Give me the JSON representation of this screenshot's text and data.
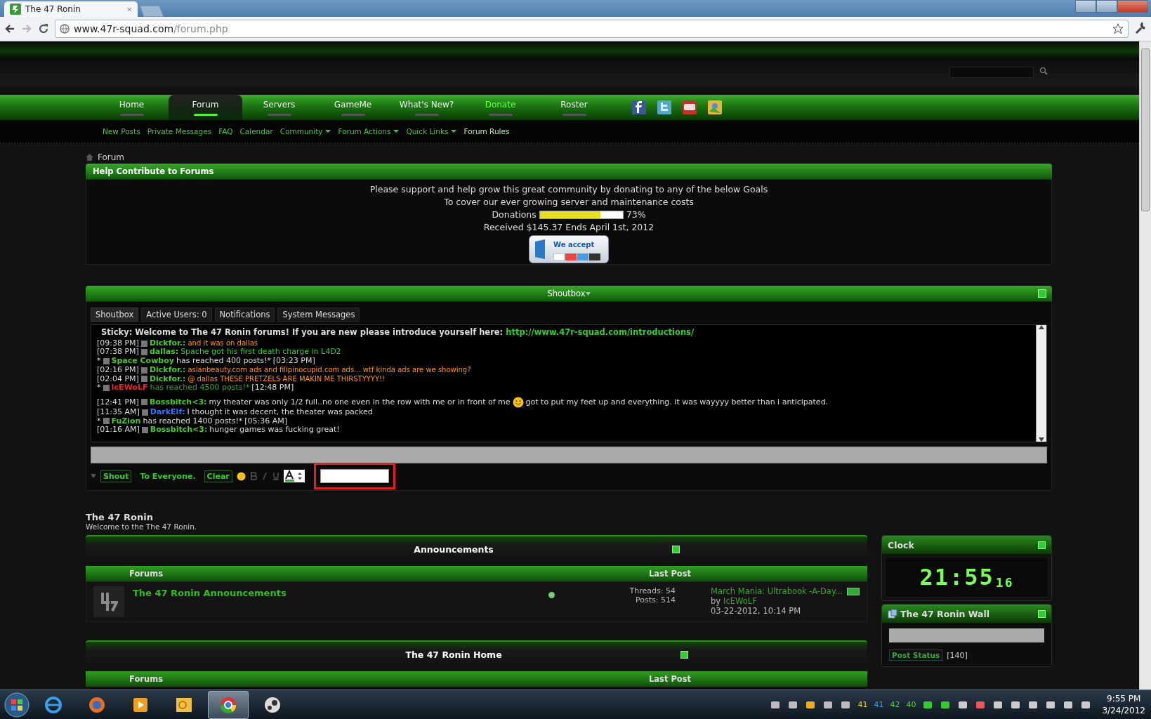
{
  "browser": {
    "tab_title": "The 47 Ronin",
    "tab_close": "×",
    "url_host": "www.47r-squad.com",
    "url_path": "/forum.php"
  },
  "nav": [
    {
      "label": "Home",
      "selected": false,
      "highlighted": false
    },
    {
      "label": "Forum",
      "selected": true,
      "highlighted": false
    },
    {
      "label": "Servers",
      "selected": false,
      "highlighted": false
    },
    {
      "label": "GameMe",
      "selected": false,
      "highlighted": false
    },
    {
      "label": "What's New?",
      "selected": false,
      "highlighted": false
    },
    {
      "label": "Donate",
      "selected": false,
      "highlighted": true
    },
    {
      "label": "Roster",
      "selected": false,
      "highlighted": false
    }
  ],
  "social": [
    {
      "kind": "facebook",
      "color": "#3b5998"
    },
    {
      "kind": "twitter",
      "color": "#5aa6c8"
    },
    {
      "kind": "youtube",
      "color": "#c4302b"
    },
    {
      "kind": "maps",
      "color": "#e8b43a"
    }
  ],
  "subnav": [
    {
      "label": "New Posts",
      "dropdown": false,
      "current": false
    },
    {
      "label": "Private Messages",
      "dropdown": false,
      "current": false
    },
    {
      "label": "FAQ",
      "dropdown": false,
      "current": false
    },
    {
      "label": "Calendar",
      "dropdown": false,
      "current": false
    },
    {
      "label": "Community",
      "dropdown": true,
      "current": false
    },
    {
      "label": "Forum Actions",
      "dropdown": true,
      "current": false
    },
    {
      "label": "Quick Links",
      "dropdown": true,
      "current": false
    },
    {
      "label": "Forum Rules",
      "dropdown": false,
      "current": true
    }
  ],
  "breadcrumb": "Forum",
  "donation": {
    "title": "Help Contribute to Forums",
    "lines": [
      "Please support and help grow this great community by donating to any of the below Goals",
      "To cover our ever growing server and maintenance costs"
    ],
    "bar_label": "Donations",
    "level": 0.73,
    "percent": "73%",
    "received": "Received $145.37 Ends April 1st, 2012",
    "badge": "We accept"
  },
  "shoutbox": {
    "title": "Shoutbox",
    "tabs": [
      {
        "label": "Shoutbox",
        "selected": true
      },
      {
        "label": "Active Users: 0",
        "selected": false
      },
      {
        "label": "Notifications",
        "selected": false
      },
      {
        "label": "System Messages",
        "selected": false
      }
    ],
    "sticky": "Sticky: Welcome to The 47 Ronin forums! If you are new please introduce yourself here:",
    "sticky_link": "http://www.47r-squad.com/introductions/",
    "messages": [
      {
        "kind": "chat",
        "time": "[09:38 PM]",
        "user": {
          "name": "Dickfor.:",
          "color": "#44cc22"
        },
        "message": {
          "text": "and it was on dallas",
          "color": "#ff9900",
          "small": true
        }
      },
      {
        "kind": "chat",
        "time": "[07:38 PM]",
        "user": {
          "name": "dallas:",
          "color": "#44cc22"
        },
        "message": {
          "text": "Spache got his first death charge in L4D2",
          "color": "#33cc33",
          "small": false
        }
      },
      {
        "kind": "milestone",
        "lead": "*",
        "user": {
          "name": "Space Cowboy",
          "color": "#44cc22"
        },
        "message": {
          "text": "has reached 400 posts!*",
          "color": "#dddddd",
          "small": false
        },
        "time": "[03:23 PM]"
      },
      {
        "kind": "chat",
        "time": "[02:16 PM]",
        "user": {
          "name": "Dickfor.:",
          "color": "#44cc22"
        },
        "message": {
          "text": "asianbeauty.com ads and filipinocupid.com ads... wtf kinda ads are we showing?",
          "color": "#ff9900",
          "small": true
        }
      },
      {
        "kind": "chat",
        "time": "[02:04 PM]",
        "user": {
          "name": "Dickfor.:",
          "color": "#44cc22"
        },
        "message": {
          "text": "@ dallas THESE PRETZELS ARE MAKIN ME THIRSTYYYY!!",
          "color": "#ff9900",
          "small": true
        }
      },
      {
        "kind": "milestone",
        "lead": "*",
        "user": {
          "name": "IcEWoLF",
          "color": "#ee2222"
        },
        "message": {
          "text": "has reached 4500 posts!*",
          "color": "#33aa33",
          "small": false
        },
        "time": "[12:48 PM]"
      },
      {
        "kind": "chat",
        "time": "[12:41 PM]",
        "user": {
          "name": "Bossbitch<3:",
          "color": "#44cc22"
        },
        "message": {
          "text": "my theater was only 1/2 full..no one even in the row with me or in front of me",
          "color": "#dddddd",
          "small": false
        },
        "message_after": {
          "text": "got to put my feet up and everything. it was wayyyy better than i anticipated.",
          "color": "#dddddd",
          "small": false
        }
      },
      {
        "kind": "chat",
        "time": "[11:35 AM]",
        "user": {
          "name": "DarkElf:",
          "color": "#3377ff"
        },
        "message": {
          "text": "I thought it was decent, the theater was packed",
          "color": "#dddddd",
          "small": false
        }
      },
      {
        "kind": "milestone",
        "lead": "*",
        "user": {
          "name": "FuZion",
          "color": "#44cc22"
        },
        "message": {
          "text": "has reached 1400 posts!*",
          "color": "#dddddd",
          "small": false
        },
        "time": "[05:36 AM]"
      },
      {
        "kind": "chat",
        "time": "[01:16 AM]",
        "user": {
          "name": "Bossbitch<3:",
          "color": "#44cc22"
        },
        "message": {
          "text": "hunger games was fucking great!",
          "color": "#dddddd",
          "small": false
        }
      }
    ],
    "controls": {
      "shout": "Shout",
      "target": "To Everyone.",
      "clear": "Clear"
    }
  },
  "forum_home": {
    "title": "The 47 Ronin",
    "subtitle": "Welcome to the The 47 Ronin.",
    "categories": [
      {
        "title": "Announcements",
        "col_forums": "Forums",
        "col_last": "Last Post",
        "forums": [
          {
            "name": "The 47 Ronin Announcements",
            "threads": "Threads: 54",
            "posts": "Posts: 514",
            "last_title": "March Mania: Ultrabook -A-Day...",
            "by": "by",
            "last_user": "IcEWoLF",
            "last_date": "03-22-2012,",
            "last_time": "10:14 PM"
          }
        ]
      },
      {
        "title": "The 47 Ronin Home",
        "col_forums": "Forums",
        "col_last": "Last Post"
      }
    ]
  },
  "sidebar": {
    "clock_title": "Clock",
    "clock_time": "21:55",
    "clock_seconds": "16",
    "wall_title": "The 47 Ronin Wall",
    "post_status": "Post Status",
    "count": "[140]"
  },
  "taskbar": {
    "apps": [
      {
        "kind": "ie",
        "active": false
      },
      {
        "kind": "firefox",
        "active": false
      },
      {
        "kind": "media",
        "active": false
      },
      {
        "kind": "outlook",
        "active": false
      },
      {
        "kind": "chrome",
        "active": true
      },
      {
        "kind": "steam",
        "active": false
      }
    ],
    "temps": [
      {
        "value": "41",
        "color": "#e8d040"
      },
      {
        "value": "41",
        "color": "#3a9ee8"
      },
      {
        "value": "42",
        "color": "#55cc44"
      },
      {
        "value": "40",
        "color": "#55cc44"
      }
    ],
    "time": "9:55 PM",
    "date": "3/24/2012"
  }
}
